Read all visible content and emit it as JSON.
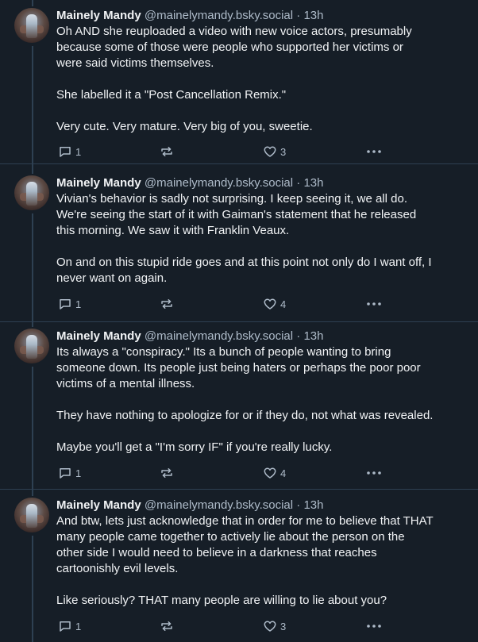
{
  "posts": [
    {
      "author": "Mainely Mandy",
      "handle": "@mainelymandy.bsky.social",
      "separator": "·",
      "time": "13h",
      "text": "Oh AND she reuploaded a video with new voice actors, presumably\nbecause some of those were people who supported her victims or\nwere said victims themselves.\n\nShe labelled it a \"Post Cancellation Remix.\"\n\nVery cute. Very mature. Very big of you, sweetie.",
      "replies": "1",
      "reposts": "",
      "likes": "3"
    },
    {
      "author": "Mainely Mandy",
      "handle": "@mainelymandy.bsky.social",
      "separator": "·",
      "time": "13h",
      "text": "Vivian's behavior is sadly not surprising. I keep seeing it, we all do.\nWe're seeing the start of it with Gaiman's statement that he released\nthis morning. We saw it with Franklin Veaux.\n\nOn and on this stupid ride goes and at this point not only do I want off, I\nnever want on again.",
      "replies": "1",
      "reposts": "",
      "likes": "4"
    },
    {
      "author": "Mainely Mandy",
      "handle": "@mainelymandy.bsky.social",
      "separator": "·",
      "time": "13h",
      "text": "Its always a \"conspiracy.\" Its a bunch of people wanting to bring\nsomeone down. Its people just being haters or perhaps the poor poor\nvictims of a mental illness.\n\nThey have nothing to apologize for or if they do, not what was revealed.\n\nMaybe you'll get a \"I'm sorry IF\" if you're really lucky.",
      "replies": "1",
      "reposts": "",
      "likes": "4"
    },
    {
      "author": "Mainely Mandy",
      "handle": "@mainelymandy.bsky.social",
      "separator": "·",
      "time": "13h",
      "text": "And btw, lets just acknowledge that in order for me to believe that THAT\nmany people came together to actively lie about the person on the\nother side I would need to believe in a darkness that reaches\ncartoonishly evil levels.\n\nLike seriously? THAT many people are willing to lie about you?",
      "replies": "1",
      "reposts": "",
      "likes": "3"
    }
  ],
  "icons": {
    "reply": "speech-bubble-icon",
    "repost": "repost-arrows-icon",
    "like": "heart-outline-icon",
    "more": "ellipsis-icon"
  },
  "colors": {
    "background": "#161e27",
    "text": "#f1f3f5",
    "muted": "#aebbc9",
    "border": "#2e4052"
  }
}
